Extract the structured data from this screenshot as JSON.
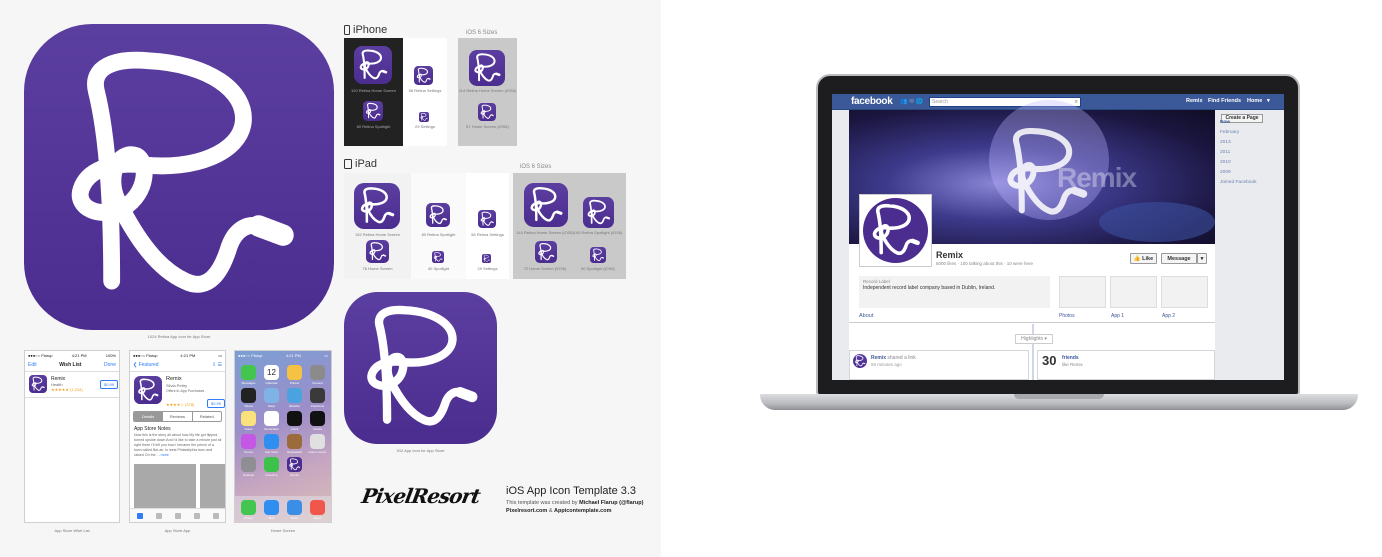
{
  "template": {
    "large_icon_caption": "1024 Retina App Icon for App Store",
    "iphone_section": "iPhone",
    "ipad_section": "iPad",
    "ios6_label": "iOS 6 Sizes",
    "iphone_icons": [
      {
        "caption": "120 Retina Home Screen"
      },
      {
        "caption": "58 Retina Settings"
      },
      {
        "caption": "80 Retina Spotlight"
      },
      {
        "caption": "29 Settings"
      }
    ],
    "iphone_ios6_icons": [
      {
        "caption": "114 Retina Home Screen (iOS6)"
      },
      {
        "caption": "57 Home Screen (iOS6)"
      }
    ],
    "ipad_icons": [
      {
        "caption": "152 Retina Home Screen"
      },
      {
        "caption": "80 Retina Spotlight"
      },
      {
        "caption": "58 Retina Settings"
      },
      {
        "caption": "76 Home Screen"
      },
      {
        "caption": "40 Spotlight"
      },
      {
        "caption": "29 Settings"
      }
    ],
    "ipad_ios6_icons": [
      {
        "caption": "144 Retina Home Screen (iOS6)"
      },
      {
        "caption": "100 Retina Spotlight (iOS6)"
      },
      {
        "caption": "72 Home Screen (iOS6)"
      },
      {
        "caption": "50 Spotlight (iOS6)"
      }
    ],
    "medium_icon_caption": "512 App Icon for App Store",
    "screens": {
      "wishlist_caption": "App Store Wish List",
      "appstore_caption": "App Store App",
      "home_caption": "Home Screen"
    },
    "brand": "PixelResort",
    "title": "iOS App Icon Template 3.3",
    "credit_prefix": "This template was created by",
    "credit_author": "Michael Flarup (@flarup)",
    "site1": "Pixelresort.com",
    "site_and": "&",
    "site2": "Appicontemplate.com"
  },
  "wishlist": {
    "carrier": "●●●○○ Flarup",
    "time": "4:21 PM",
    "battery": "100%",
    "edit": "Edit",
    "title": "Wish List",
    "done": "Done",
    "app_name": "Remix",
    "app_seller": "Health",
    "app_rating": "★★★★★ (1,234)",
    "price": "$0.99"
  },
  "appstore": {
    "carrier": "●●●○○ Flarup",
    "time": "4:21 PM",
    "back": "❮ Featured",
    "app_name": "Remix",
    "app_seller": "Silvia Pettry",
    "app_age": "Offers In-App Purchases",
    "rating": "★★★★☆ (378)",
    "price": "$0.99",
    "tabs": [
      "Details",
      "Reviews",
      "Related"
    ],
    "notes_title": "App Store Notes",
    "notes_body": "Now this is the story all about how My life got flipped, turned upside down And I'd like to take a minute just sit right there I'll tell you how I became the prince of a town called Bel-air. In west Philadelphia born and raised On the ...",
    "more": "more"
  },
  "home": {
    "carrier": "●●●○○ Flarup",
    "time": "4:21 PM",
    "date_num": "12",
    "apps": [
      "Messages",
      "Calendar",
      "Photos",
      "Camera",
      "Videos",
      "Maps",
      "Weather",
      "Passbook",
      "Notes",
      "Reminders",
      "Clock",
      "Stocks",
      "iTunes",
      "App Store",
      "Newsstand",
      "Game Center",
      "Settings",
      "Facetime",
      "Remix",
      ""
    ],
    "dock": [
      "Phone",
      "Mail",
      "Safari",
      "Music"
    ]
  },
  "facebook": {
    "logo": "facebook",
    "search_placeholder": "Search",
    "nav_remix": "Remix",
    "nav_find": "Find Friends",
    "nav_home": "Home",
    "cover_word": "Remix",
    "page_name": "Remix",
    "stats": "5000 likes · 100 talking about this · 10 were here",
    "like_btn": "👍 Like",
    "message_btn": "Message",
    "about_cat": "Record Label",
    "about_text": "Independent record label company based in Dublin, Ireland.",
    "about_link": "About",
    "tabs": [
      "Photos",
      "App 1",
      "App 2"
    ],
    "highlights": "Highlights ▾",
    "create_page": "Create a Page",
    "timeline": [
      "Now",
      "February",
      "2013",
      "2011",
      "2010",
      "2009",
      "Joined Facebook"
    ],
    "post_name": "Remix",
    "post_action": "shared a link",
    "post_time": "55 minutes ago",
    "friends_count": "30",
    "friends_label": "friends",
    "friends_sub": "like Remix"
  },
  "colors": {
    "icon_purple": "#4b2c8f",
    "fb_blue": "#3b5998",
    "ios_blue": "#2f7cf6"
  }
}
